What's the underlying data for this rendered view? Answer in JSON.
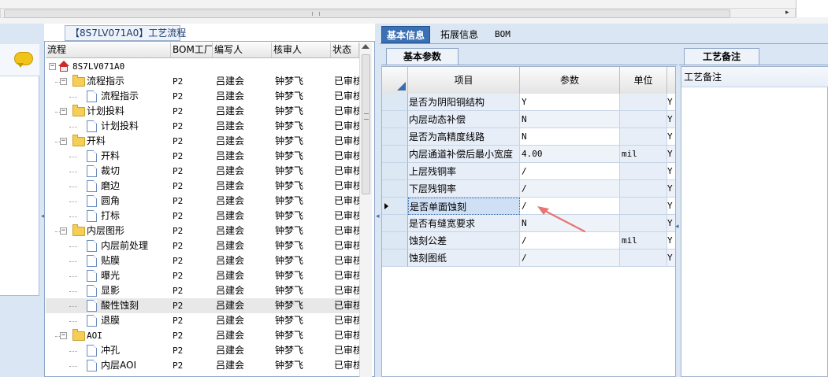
{
  "top_scrollbar": {
    "right_arrow": "▸"
  },
  "left_panel": {
    "comment_icon": "speech-bubble-icon",
    "collapse_arrow": "◂"
  },
  "tree": {
    "title": "【8S7LV071A0】工艺流程",
    "columns": [
      "流程",
      "BOM工厂",
      "编写人",
      "核审人",
      "状态"
    ],
    "rows": [
      {
        "label": "8S7LV071A0",
        "bom": "",
        "writer": "",
        "reviewer": "",
        "status": "",
        "level": 0,
        "kind": "root",
        "mono": true
      },
      {
        "label": "流程指示",
        "bom": "P2",
        "writer": "吕建会",
        "reviewer": "钟梦飞",
        "status": "已审核",
        "level": 1,
        "kind": "folder"
      },
      {
        "label": "流程指示",
        "bom": "P2",
        "writer": "吕建会",
        "reviewer": "钟梦飞",
        "status": "已审核",
        "level": 2,
        "kind": "doc"
      },
      {
        "label": "计划投料",
        "bom": "P2",
        "writer": "吕建会",
        "reviewer": "钟梦飞",
        "status": "已审核",
        "level": 1,
        "kind": "folder"
      },
      {
        "label": "计划投料",
        "bom": "P2",
        "writer": "吕建会",
        "reviewer": "钟梦飞",
        "status": "已审核",
        "level": 2,
        "kind": "doc"
      },
      {
        "label": "开料",
        "bom": "P2",
        "writer": "吕建会",
        "reviewer": "钟梦飞",
        "status": "已审核",
        "level": 1,
        "kind": "folder"
      },
      {
        "label": "开料",
        "bom": "P2",
        "writer": "吕建会",
        "reviewer": "钟梦飞",
        "status": "已审核",
        "level": 2,
        "kind": "doc"
      },
      {
        "label": "裁切",
        "bom": "P2",
        "writer": "吕建会",
        "reviewer": "钟梦飞",
        "status": "已审核",
        "level": 2,
        "kind": "doc"
      },
      {
        "label": "磨边",
        "bom": "P2",
        "writer": "吕建会",
        "reviewer": "钟梦飞",
        "status": "已审核",
        "level": 2,
        "kind": "doc"
      },
      {
        "label": "圆角",
        "bom": "P2",
        "writer": "吕建会",
        "reviewer": "钟梦飞",
        "status": "已审核",
        "level": 2,
        "kind": "doc"
      },
      {
        "label": "打标",
        "bom": "P2",
        "writer": "吕建会",
        "reviewer": "钟梦飞",
        "status": "已审核",
        "level": 2,
        "kind": "doc"
      },
      {
        "label": "内层图形",
        "bom": "P2",
        "writer": "吕建会",
        "reviewer": "钟梦飞",
        "status": "已审核",
        "level": 1,
        "kind": "folder"
      },
      {
        "label": "内层前处理",
        "bom": "P2",
        "writer": "吕建会",
        "reviewer": "钟梦飞",
        "status": "已审核",
        "level": 2,
        "kind": "doc"
      },
      {
        "label": "贴膜",
        "bom": "P2",
        "writer": "吕建会",
        "reviewer": "钟梦飞",
        "status": "已审核",
        "level": 2,
        "kind": "doc"
      },
      {
        "label": "曝光",
        "bom": "P2",
        "writer": "吕建会",
        "reviewer": "钟梦飞",
        "status": "已审核",
        "level": 2,
        "kind": "doc"
      },
      {
        "label": "显影",
        "bom": "P2",
        "writer": "吕建会",
        "reviewer": "钟梦飞",
        "status": "已审核",
        "level": 2,
        "kind": "doc"
      },
      {
        "label": "酸性蚀刻",
        "bom": "P2",
        "writer": "吕建会",
        "reviewer": "钟梦飞",
        "status": "已审核",
        "level": 2,
        "kind": "doc",
        "selected": true
      },
      {
        "label": "退膜",
        "bom": "P2",
        "writer": "吕建会",
        "reviewer": "钟梦飞",
        "status": "已审核",
        "level": 2,
        "kind": "doc"
      },
      {
        "label": "AOI",
        "bom": "P2",
        "writer": "吕建会",
        "reviewer": "钟梦飞",
        "status": "已审核",
        "level": 1,
        "kind": "folder",
        "mono": true
      },
      {
        "label": "冲孔",
        "bom": "P2",
        "writer": "吕建会",
        "reviewer": "钟梦飞",
        "status": "已审核",
        "level": 2,
        "kind": "doc"
      },
      {
        "label": "内层AOI",
        "bom": "P2",
        "writer": "吕建会",
        "reviewer": "钟梦飞",
        "status": "已审核",
        "level": 2,
        "kind": "doc"
      }
    ]
  },
  "tabs": {
    "main": [
      {
        "label": "基本信息",
        "active": true,
        "mono": false
      },
      {
        "label": "拓展信息",
        "active": false,
        "mono": false
      },
      {
        "label": "BOM",
        "active": false,
        "mono": true
      }
    ],
    "basic_params": "基本参数",
    "process_note": "工艺备注"
  },
  "grid": {
    "headers": {
      "item": "项目",
      "param": "参数",
      "unit": "单位"
    },
    "rows": [
      {
        "item": "是否为阴阳铜结构",
        "param": "Y",
        "unit": "",
        "flag": "Y",
        "editable": true
      },
      {
        "item": "内层动态补偿",
        "param": "N",
        "unit": "",
        "flag": "Y",
        "editable": false
      },
      {
        "item": "是否为高精度线路",
        "param": "N",
        "unit": "",
        "flag": "Y",
        "editable": true
      },
      {
        "item": "内层通道补偿后最小宽度",
        "param": "4.00",
        "unit": "mil",
        "flag": "Y",
        "editable": false
      },
      {
        "item": "上层残铜率",
        "param": "/",
        "unit": "",
        "flag": "Y",
        "editable": true
      },
      {
        "item": "下层残铜率",
        "param": "/",
        "unit": "",
        "flag": "Y",
        "editable": false
      },
      {
        "item": "是否单面蚀刻",
        "param": "/",
        "unit": "",
        "flag": "Y",
        "editable": true,
        "selected": true
      },
      {
        "item": "是否有缝宽要求",
        "param": "N",
        "unit": "",
        "flag": "Y",
        "editable": false
      },
      {
        "item": "蚀刻公差",
        "param": "/",
        "unit": "mil",
        "flag": "Y",
        "editable": true
      },
      {
        "item": "蚀刻图纸",
        "param": "/",
        "unit": "",
        "flag": "Y",
        "editable": false
      }
    ]
  },
  "note": {
    "header": "工艺备注"
  },
  "colors": {
    "accent_tab": "#3b70b4",
    "panel_bg": "#dbe6f4",
    "annotation_arrow": "#e87474"
  }
}
